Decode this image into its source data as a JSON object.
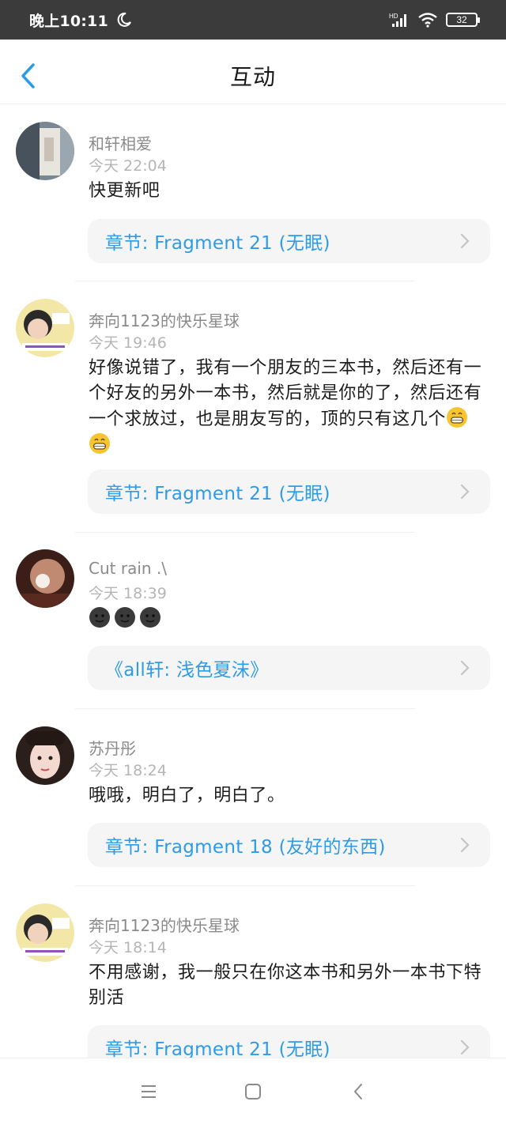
{
  "status_bar": {
    "time": "晚上10:11",
    "network": "HD",
    "battery": "32"
  },
  "header": {
    "title": "互动"
  },
  "items": [
    {
      "name": "和轩相爱",
      "time": "今天 22:04",
      "content": "快更新吧",
      "emojis": [],
      "ref": "章节: Fragment 21 (无眠)"
    },
    {
      "name": "奔向1123的快乐星球",
      "time": "今天 19:46",
      "content": "好像说错了，我有一个朋友的三本书，然后还有一个好友的另外一本书，然后就是你的了，然后还有一个求放过，也是朋友写的，顶的只有这几个",
      "emojis": [
        "grin-emoji",
        "grin-emoji"
      ],
      "ref": "章节: Fragment 21 (无眠)"
    },
    {
      "name": "Cut rain .\\",
      "time": "今天 18:39",
      "content": "",
      "emojis": [
        "dark-face-emoji",
        "dark-face-emoji",
        "dark-face-emoji"
      ],
      "ref": "《all轩: 浅色夏沫》"
    },
    {
      "name": "苏丹彤",
      "time": "今天 18:24",
      "content": "哦哦，明白了，明白了。",
      "emojis": [],
      "ref": "章节: Fragment 18 (友好的东西)"
    },
    {
      "name": "奔向1123的快乐星球",
      "time": "今天 18:14",
      "content": "不用感谢，我一般只在你这本书和另外一本书下特别活",
      "emojis": [],
      "ref": "章节: Fragment 21 (无眠)"
    }
  ],
  "colors": {
    "accent": "#2e9be6",
    "status_bar_bg": "#3b3b3b",
    "ref_bg": "#f5f5f5"
  },
  "icons": {
    "back": "chevron-left-icon",
    "ref_arrow": "chevron-right-icon",
    "nav": [
      "menu-icon",
      "home-square-icon",
      "back-triangle-icon"
    ]
  }
}
